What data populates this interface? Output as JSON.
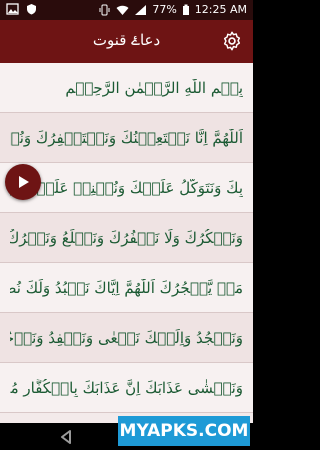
{
  "status": {
    "battery": "77%",
    "time": "12:25 AM"
  },
  "app": {
    "title": "دعاۓ قنوت"
  },
  "lines": [
    "بِسۡمِ اللّٰهِ الرَّحۡمٰنِ الرَّحِيۡمِ",
    "اَللّٰهُمَّ اِنَّا نَسۡتَعِيۡنُكَ وَنَسۡتَغۡفِرُكَ وَنُؤۡمِنُ",
    "بِكَ وَنَتَوَكَّلُ عَلَيۡكَ وَنُثۡنِيۡ عَلَيۡكَ الۡخَيۡرَ",
    "وَنَشۡكُرُكَ وَلَا نَكۡفُرُكَ وَنَخۡلَعُ وَنَتۡرُكُ",
    "مَنۡ يَّفۡجُرُكَ اَللّٰهُمَّ اِيَّاكَ نَعۡبُدُ وَلَكَ نُصَلِّىۡ",
    "وَنَسۡجُدُ وَاِلَيۡكَ نَسۡعٰى وَنَحۡفِدُ وَنَرۡجُوۡ رَحۡمَتَكَ",
    "وَنَخۡشٰى عَذَابَكَ اِنَّ عَذَابَكَ بِالۡكُفَّارِ مُلۡحِقٌ"
  ],
  "watermark": "MYAPKS.COM"
}
